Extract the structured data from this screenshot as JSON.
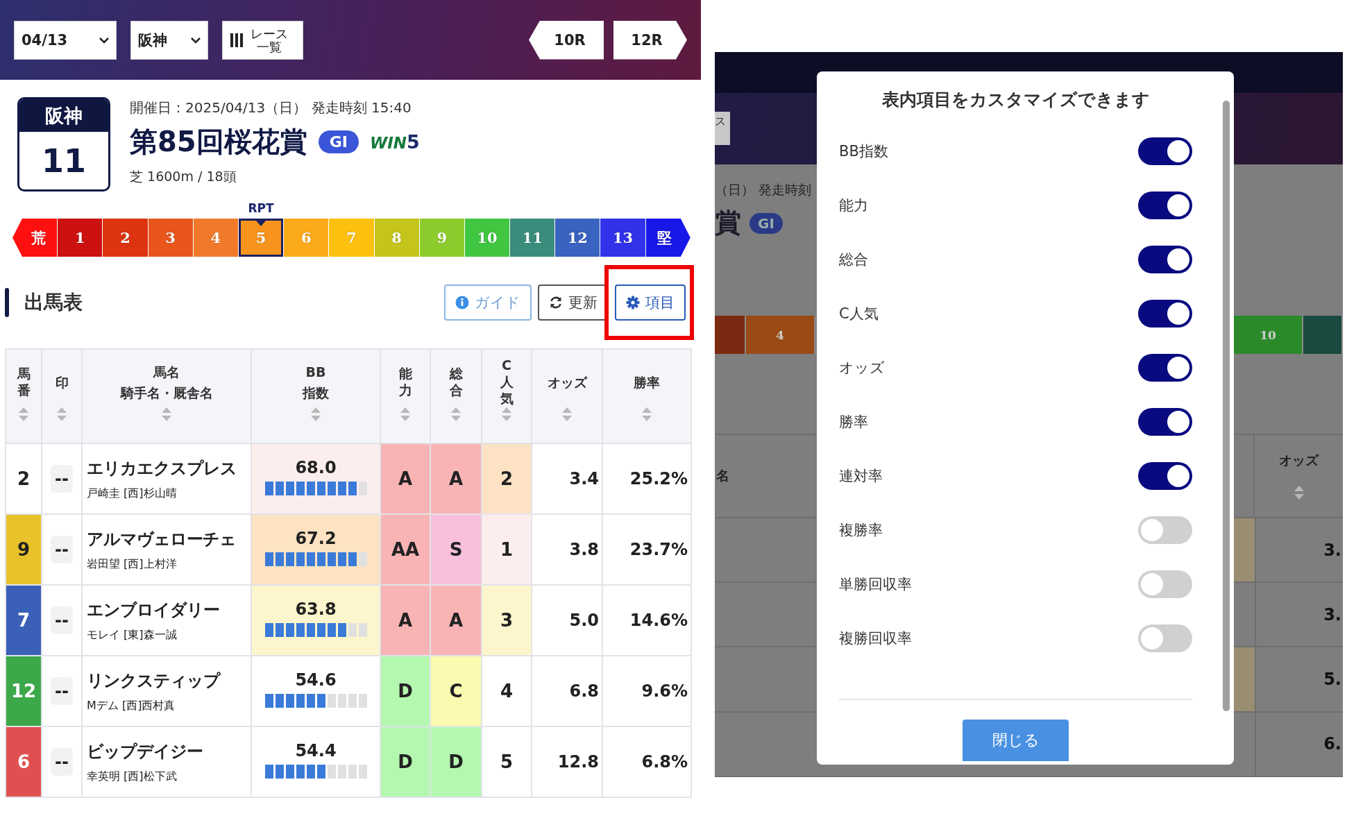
{
  "header": {
    "date_select": "04/13",
    "venue_select": "阪神",
    "race_list_button": [
      "レース",
      "一覧"
    ],
    "prev_race": "10R",
    "next_race": "12R"
  },
  "race": {
    "venue": "阪神",
    "number": "11",
    "date_line": "開催日：2025/04/13（日） 発走時刻 15:40",
    "title": "第85回桜花賞",
    "grade": "GI",
    "win5": {
      "word": "WIN",
      "digit": "5"
    },
    "course": "芝 1600m / 18頭"
  },
  "rpt": {
    "label": "RPT",
    "segments": [
      {
        "text": "荒",
        "kind": "end-left",
        "color": "#ff1010",
        "selected": false
      },
      {
        "text": "1",
        "kind": "step",
        "color": "#cc1111",
        "selected": false
      },
      {
        "text": "2",
        "kind": "step",
        "color": "#dd3311",
        "selected": false
      },
      {
        "text": "3",
        "kind": "step",
        "color": "#e8561c",
        "selected": false
      },
      {
        "text": "4",
        "kind": "step",
        "color": "#f07a2a",
        "selected": false
      },
      {
        "text": "5",
        "kind": "step",
        "color": "#f7941d",
        "selected": true
      },
      {
        "text": "6",
        "kind": "step",
        "color": "#fbaa1a",
        "selected": false
      },
      {
        "text": "7",
        "kind": "step",
        "color": "#fcc10f",
        "selected": false
      },
      {
        "text": "8",
        "kind": "step",
        "color": "#c4c41c",
        "selected": false
      },
      {
        "text": "9",
        "kind": "step",
        "color": "#8ccb2c",
        "selected": false
      },
      {
        "text": "10",
        "kind": "step",
        "color": "#40c640",
        "selected": false
      },
      {
        "text": "11",
        "kind": "step",
        "color": "#3a8c7c",
        "selected": false
      },
      {
        "text": "12",
        "kind": "step",
        "color": "#3a62c0",
        "selected": false
      },
      {
        "text": "13",
        "kind": "step",
        "color": "#3232ea",
        "selected": false
      },
      {
        "text": "堅",
        "kind": "end-right",
        "color": "#1818e8",
        "selected": false
      }
    ]
  },
  "entries": {
    "title": "出馬表",
    "buttons": [
      {
        "kind": "guide",
        "label": "ガイド",
        "highlighted": false
      },
      {
        "kind": "refresh",
        "label": "更新",
        "highlighted": false
      },
      {
        "kind": "settings",
        "label": "項目",
        "highlighted": true
      }
    ]
  },
  "table": {
    "columns": [
      {
        "lines": [
          "馬",
          "番"
        ]
      },
      {
        "lines": [
          "印"
        ]
      },
      {
        "lines": [
          "馬名",
          "騎手名・厩舎名"
        ]
      },
      {
        "lines": [
          "BB",
          "指数"
        ]
      },
      {
        "lines": [
          "能",
          "力"
        ]
      },
      {
        "lines": [
          "総",
          "合"
        ]
      },
      {
        "lines": [
          "C",
          "人",
          "気"
        ]
      },
      {
        "lines": [
          "オッズ"
        ]
      },
      {
        "lines": [
          "勝率"
        ]
      }
    ],
    "rows": [
      {
        "number": "2",
        "color": "#ffffff",
        "mark": "--",
        "horse": "エリカエクスプレス",
        "connections": "戸崎圭 [西]杉山晴",
        "bb": {
          "value": "68.0",
          "level": 0.9,
          "color": "#fdeeee"
        },
        "ability": {
          "text": "A",
          "color": "#f8b4b4"
        },
        "overall": {
          "text": "A",
          "color": "#f8b4b4"
        },
        "popularity": {
          "text": "2",
          "color": "#fde2c4"
        },
        "odds": "3.4",
        "win_rate": "25.2%"
      },
      {
        "number": "9",
        "color": "#e8c22a",
        "mark": "--",
        "horse": "アルマヴェローチェ",
        "connections": "岩田望 [西]上村洋",
        "bb": {
          "value": "67.2",
          "level": 0.9,
          "color": "#fde3c2"
        },
        "ability": {
          "text": "AA",
          "color": "#f8b4b4"
        },
        "overall": {
          "text": "S",
          "color": "#f8c0dc"
        },
        "popularity": {
          "text": "1",
          "color": "#fdeeee"
        },
        "odds": "3.8",
        "win_rate": "23.7%"
      },
      {
        "number": "7",
        "color": "#3a60b8",
        "mark": "--",
        "horse": "エンブロイダリー",
        "connections": "モレイ [東]森一誠",
        "bb": {
          "value": "63.8",
          "level": 0.8,
          "color": "#fdf6cc"
        },
        "ability": {
          "text": "A",
          "color": "#f8b4b4"
        },
        "overall": {
          "text": "A",
          "color": "#f8b4b4"
        },
        "popularity": {
          "text": "3",
          "color": "#fdf6cc"
        },
        "odds": "5.0",
        "win_rate": "14.6%"
      },
      {
        "number": "12",
        "color": "#3ca84a",
        "mark": "--",
        "horse": "リンクスティップ",
        "connections": "Mデム [西]西村真",
        "bb": {
          "value": "54.6",
          "level": 0.6,
          "color": "#ffffff"
        },
        "ability": {
          "text": "D",
          "color": "#b4f8b0"
        },
        "overall": {
          "text": "C",
          "color": "#fafab0"
        },
        "popularity": {
          "text": "4",
          "color": "#ffffff"
        },
        "odds": "6.8",
        "win_rate": "9.6%"
      },
      {
        "number": "6",
        "color": "#e05050",
        "mark": "--",
        "horse": "ビップデイジー",
        "connections": "幸英明 [西]松下武",
        "bb": {
          "value": "54.4",
          "level": 0.6,
          "color": "#ffffff"
        },
        "ability": {
          "text": "D",
          "color": "#b4f8b0"
        },
        "overall": {
          "text": "D",
          "color": "#b4f8b0"
        },
        "popularity": {
          "text": "5",
          "color": "#ffffff"
        },
        "odds": "12.8",
        "win_rate": "6.8%"
      }
    ]
  },
  "backdrop": {
    "race_list_fragment": "ス",
    "date_fragment": "（日） 発走時刻",
    "title_fragment": "賞",
    "grade": "GI",
    "rpt_segments": [
      {
        "text": "4",
        "color": "#9a4a14"
      },
      {
        "text": "10",
        "color": "#2a8a2a"
      }
    ],
    "name_header_fragment": "名",
    "odds_header": "オッズ",
    "odds_fragments": [
      "3.",
      "3.",
      "5.",
      "6."
    ]
  },
  "modal": {
    "title": "表内項目をカスタマイズできます",
    "items": [
      {
        "label": "BB指数",
        "on": true
      },
      {
        "label": "能力",
        "on": true
      },
      {
        "label": "総合",
        "on": true
      },
      {
        "label": "C人気",
        "on": true
      },
      {
        "label": "オッズ",
        "on": true
      },
      {
        "label": "勝率",
        "on": true
      },
      {
        "label": "連対率",
        "on": true
      },
      {
        "label": "複勝率",
        "on": false
      },
      {
        "label": "単勝回収率",
        "on": false
      },
      {
        "label": "複勝回収率",
        "on": false
      }
    ],
    "close_button": "閉じる"
  }
}
